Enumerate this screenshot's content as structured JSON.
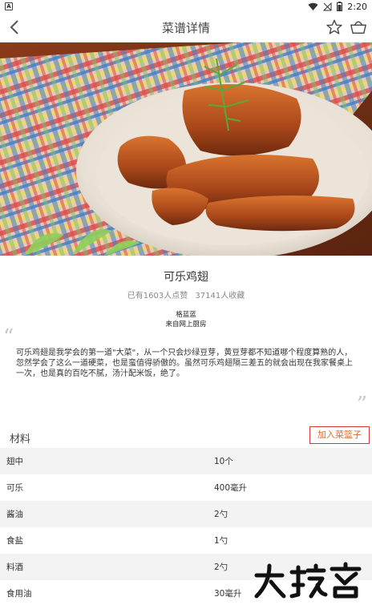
{
  "status_bar": {
    "time": "2:20"
  },
  "header": {
    "title": "菜谱详情"
  },
  "recipe": {
    "name": "可乐鸡翅",
    "likes": "已有1603人点赞",
    "favorites": "37141人收藏",
    "author_name": "格蓝蓝",
    "author_source": "来自网上厨房",
    "description": "可乐鸡翅是我学会的第一道\"大菜\"，从一个只会炒绿豆芽，黄豆芽都不知道哪个程度算熟的人，忽然学会了这么一道硬菜，也是蛮值得骄傲的。虽然可乐鸡翅隔三差五的就会出现在我家餐桌上一次，也是真的百吃不腻，汤汁配米饭，绝了。"
  },
  "materials": {
    "title": "材料",
    "add_button": "加入菜篮子",
    "items": [
      {
        "name": "翅中",
        "qty": "10个"
      },
      {
        "name": "可乐",
        "qty": "400毫升"
      },
      {
        "name": "酱油",
        "qty": "2勺"
      },
      {
        "name": "食盐",
        "qty": "1勺"
      },
      {
        "name": "料酒",
        "qty": "2勺"
      },
      {
        "name": "食用油",
        "qty": "30毫升"
      }
    ]
  },
  "watermark": {
    "text": "大玩家"
  },
  "colors": {
    "accent_border": "#d23a3a",
    "accent_text": "#e06a2b",
    "row_alt": "#f3f3f3"
  }
}
